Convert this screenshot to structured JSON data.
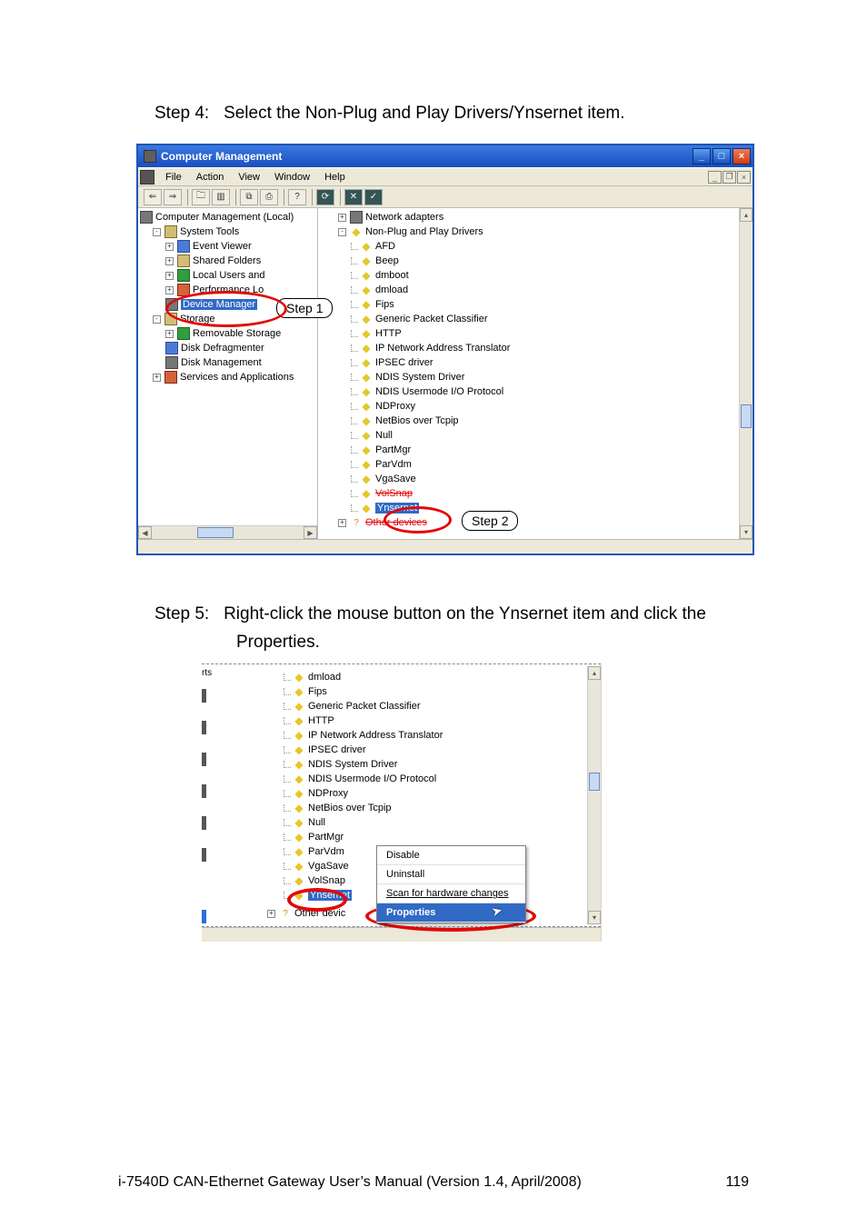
{
  "step4": {
    "label": "Step 4:",
    "text": "Select the Non-Plug and Play Drivers/Ynsernet item."
  },
  "cm": {
    "title": "Computer Management",
    "menus": {
      "file": "File",
      "action": "Action",
      "view": "View",
      "window": "Window",
      "help": "Help"
    },
    "left": {
      "root": "Computer Management (Local)",
      "system_tools": "System Tools",
      "event_viewer": "Event Viewer",
      "shared_folders": "Shared Folders",
      "local_users": "Local Users and",
      "perf_logs": "Performance Lo",
      "device_manager": "Device Manager",
      "storage": "Storage",
      "removable": "Removable Storage",
      "defrag": "Disk Defragmenter",
      "diskmgmt": "Disk Management",
      "services": "Services and Applications"
    },
    "right": {
      "network_adapters": "Network adapters",
      "npp": "Non-Plug and Play Drivers",
      "items": {
        "afd": "AFD",
        "beep": "Beep",
        "dmboot": "dmboot",
        "dmload": "dmload",
        "fips": "Fips",
        "gpc": "Generic Packet Classifier",
        "http": "HTTP",
        "ipnat": "IP Network Address Translator",
        "ipsec": "IPSEC driver",
        "ndis_sys": "NDIS System Driver",
        "ndis_uio": "NDIS Usermode I/O Protocol",
        "ndproxy": "NDProxy",
        "netbios": "NetBios over Tcpip",
        "null": "Null",
        "partmgr": "PartMgr",
        "parvdm": "ParVdm",
        "vgasave": "VgaSave",
        "volsnap": "VolSnap",
        "ynsernet": "Ynsernet"
      },
      "other_devices": "Other devices"
    },
    "callouts": {
      "step1": "Step 1",
      "step2": "Step 2"
    }
  },
  "step5": {
    "label": "Step 5:",
    "text1": "Right-click the mouse button on the Ynsernet item and click the",
    "text2": "Properties."
  },
  "cm2": {
    "topitem": "dmload",
    "items": {
      "fips": "Fips",
      "gpc": "Generic Packet Classifier",
      "http": "HTTP",
      "ipnat": "IP Network Address Translator",
      "ipsec": "IPSEC driver",
      "ndis_sys": "NDIS System Driver",
      "ndis_uio": "NDIS Usermode I/O Protocol",
      "ndproxy": "NDProxy",
      "netbios": "NetBios over Tcpip",
      "null": "Null",
      "partmgr": "PartMgr",
      "parvdm": "ParVdm",
      "vgasave": "VgaSave",
      "volsnap": "VolSnap",
      "ynsernet": "Ynsernet"
    },
    "other_devices": "Other devic",
    "ctx": {
      "disable": "Disable",
      "uninstall": "Uninstall",
      "scan": "Scan for hardware changes",
      "properties": "Properties"
    },
    "leftword": "rts"
  },
  "footer": {
    "text": "i-7540D CAN-Ethernet Gateway User’s Manual (Version 1.4, April/2008)",
    "page": "119"
  }
}
